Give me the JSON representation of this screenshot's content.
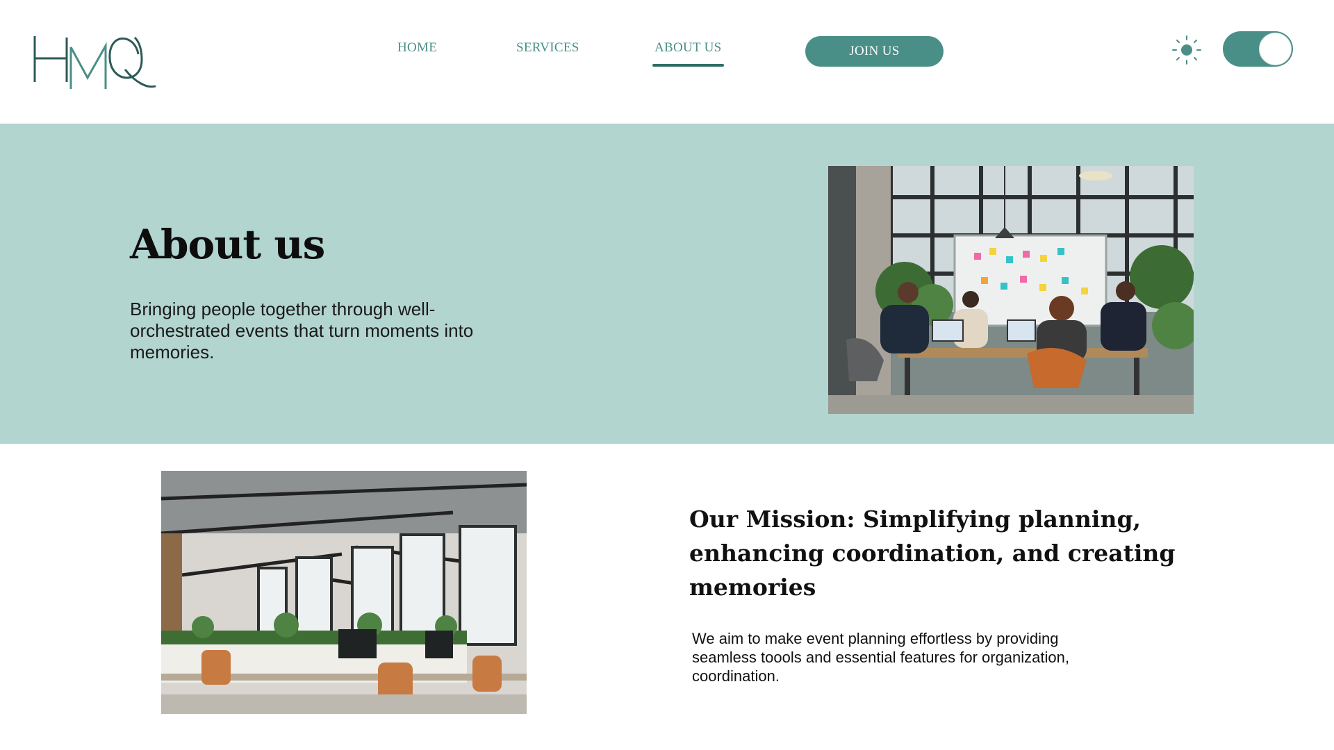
{
  "header": {
    "logo_text": "HMQ",
    "nav": [
      {
        "label": "HOME",
        "active": false
      },
      {
        "label": "SERVICES",
        "active": false
      },
      {
        "label": "ABOUT US",
        "active": true
      }
    ],
    "join_label": "JOIN US",
    "theme_icon": "sun-icon",
    "theme_toggle_on": true
  },
  "hero": {
    "title": "About us",
    "text": "Bringing people together through well-orchestrated events that turn moments into memories.",
    "image_subject": "team-meeting-photo"
  },
  "mission": {
    "title": "Our Mission: Simplifying planning, enhancing coordination, and creating memories",
    "text": "We aim to make event planning effortless by providing seamless toools and essential features for organization, coordination.",
    "image_subject": "office-interior-photo"
  },
  "colors": {
    "accent": "#4a8f87",
    "accent_dark": "#2f6e68",
    "hero_bg": "#b3d5cf",
    "logo": "#2d5a56"
  }
}
